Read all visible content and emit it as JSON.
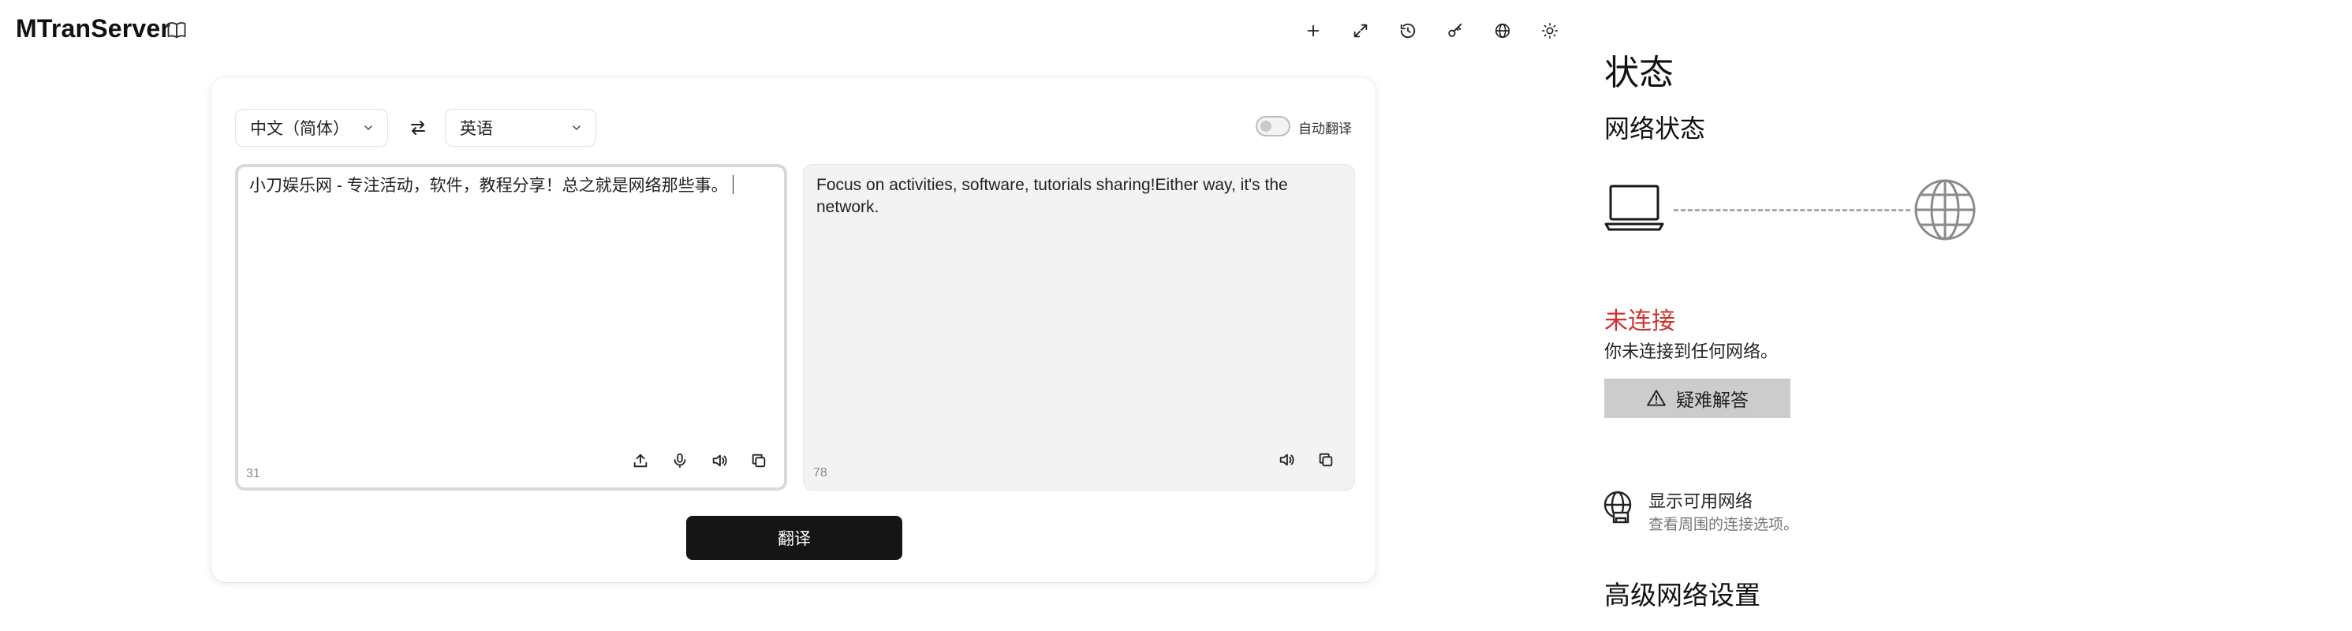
{
  "app": {
    "title": "MTranServer"
  },
  "header": {
    "icons": [
      "book-icon",
      "plus-icon",
      "expand-icon",
      "history-icon",
      "key-icon",
      "globe-icon",
      "sun-icon"
    ]
  },
  "translator": {
    "source_language": "中文（简体）",
    "target_language": "英语",
    "auto_translate_label": "自动翻译",
    "auto_translate_on": false,
    "source_text": "小刀娱乐网 - 专注活动，软件，教程分享！总之就是网络那些事。",
    "source_count": "31",
    "target_text": "Focus on activities, software, tutorials sharing!Either way, it's the network.",
    "target_count": "78",
    "translate_label": "翻译"
  },
  "status_pane": {
    "title": "状态",
    "network_heading": "网络状态",
    "connection_status": "未连接",
    "connection_desc": "你未连接到任何网络。",
    "troubleshoot_label": "疑难解答",
    "show_networks_title": "显示可用网络",
    "show_networks_sub": "查看周围的连接选项。",
    "advanced_heading": "高级网络设置"
  },
  "colors": {
    "accent_dark": "#151515",
    "disconnected_red": "#d32f2f",
    "troubleshoot_bg": "#cccccc",
    "target_panel_bg": "#f3f3f3"
  }
}
